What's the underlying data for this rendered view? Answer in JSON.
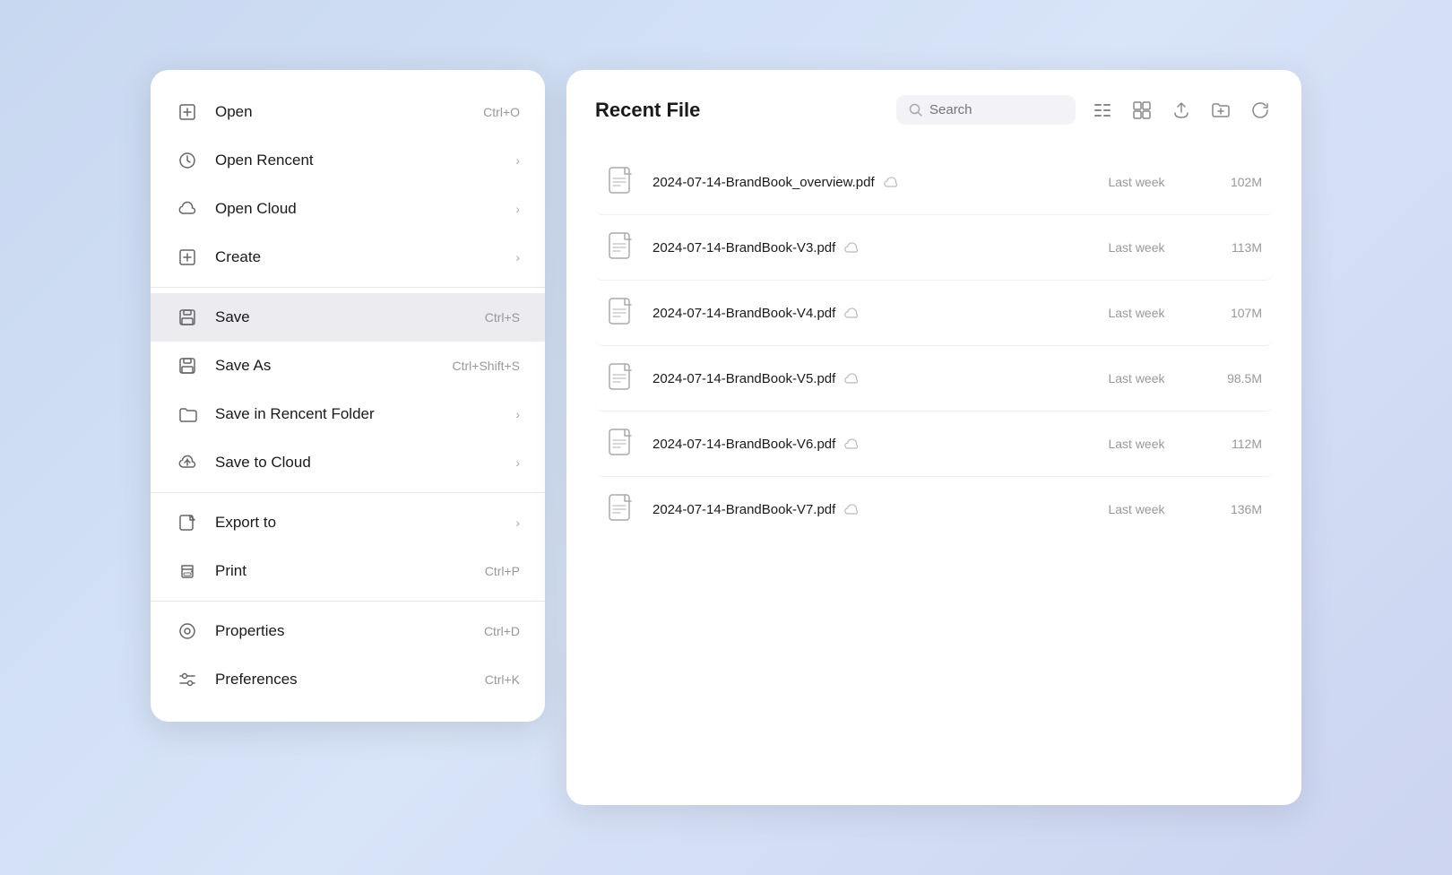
{
  "menu": {
    "items": [
      {
        "id": "open",
        "label": "Open",
        "shortcut": "Ctrl+O",
        "hasArrow": false,
        "active": false
      },
      {
        "id": "open-recent",
        "label": "Open Rencent",
        "shortcut": "",
        "hasArrow": true,
        "active": false
      },
      {
        "id": "open-cloud",
        "label": "Open Cloud",
        "shortcut": "",
        "hasArrow": true,
        "active": false
      },
      {
        "id": "create",
        "label": "Create",
        "shortcut": "",
        "hasArrow": true,
        "active": false
      },
      {
        "id": "save",
        "label": "Save",
        "shortcut": "Ctrl+S",
        "hasArrow": false,
        "active": true
      },
      {
        "id": "save-as",
        "label": "Save As",
        "shortcut": "Ctrl+Shift+S",
        "hasArrow": false,
        "active": false
      },
      {
        "id": "save-recent-folder",
        "label": "Save in Rencent Folder",
        "shortcut": "",
        "hasArrow": true,
        "active": false
      },
      {
        "id": "save-cloud",
        "label": "Save to Cloud",
        "shortcut": "",
        "hasArrow": true,
        "active": false
      },
      {
        "id": "export-to",
        "label": "Export to",
        "shortcut": "",
        "hasArrow": true,
        "active": false
      },
      {
        "id": "print",
        "label": "Print",
        "shortcut": "Ctrl+P",
        "hasArrow": false,
        "active": false
      },
      {
        "id": "properties",
        "label": "Properties",
        "shortcut": "Ctrl+D",
        "hasArrow": false,
        "active": false
      },
      {
        "id": "preferences",
        "label": "Preferences",
        "shortcut": "Ctrl+K",
        "hasArrow": false,
        "active": false
      }
    ],
    "dividers_after": [
      3,
      7,
      9
    ]
  },
  "file_panel": {
    "title": "Recent File",
    "search_placeholder": "Search",
    "files": [
      {
        "name": "2024-07-14-BrandBook_overview.pdf",
        "date": "Last week",
        "size": "102M"
      },
      {
        "name": "2024-07-14-BrandBook-V3.pdf",
        "date": "Last week",
        "size": "113M"
      },
      {
        "name": "2024-07-14-BrandBook-V4.pdf",
        "date": "Last week",
        "size": "107M"
      },
      {
        "name": "2024-07-14-BrandBook-V5.pdf",
        "date": "Last week",
        "size": "98.5M"
      },
      {
        "name": "2024-07-14-BrandBook-V6.pdf",
        "date": "Last week",
        "size": "112M"
      },
      {
        "name": "2024-07-14-BrandBook-V7.pdf",
        "date": "Last week",
        "size": "136M"
      }
    ]
  }
}
